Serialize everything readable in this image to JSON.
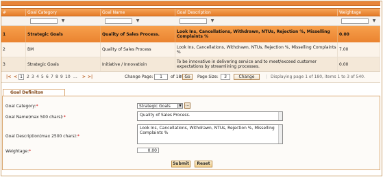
{
  "grid": {
    "columns": [
      "#",
      "Goal Category",
      "Goal Name",
      "Goal Description",
      "Weightage"
    ],
    "filter_icon": "filter-icon",
    "rows": [
      {
        "num": "1",
        "category": "Strategic Goals",
        "name": "Quality of Sales Process.",
        "description": "Look Ins, Cancellations, Withdrawn, NTUs, Rejection %, Misselling Complaints %",
        "weightage": "0.00"
      },
      {
        "num": "2",
        "category": "BM",
        "name": "Quality of Sales Process",
        "description": "Look Ins, Cancellations, Withdrawn, NTUs, Rejection %, Misselling Complaints %",
        "weightage": "7.00"
      },
      {
        "num": "3",
        "category": "Strategic Goals",
        "name": "Initiative / Innovatioin",
        "description": "To be innovative in delivering service and to meet/exceed customer expectations by streamlining processes.",
        "weightage": "0.00"
      }
    ]
  },
  "pager": {
    "first": "|<",
    "prev": "<",
    "current": "1",
    "pages": [
      "2",
      "3",
      "4",
      "5",
      "6",
      "7",
      "8",
      "9",
      "10"
    ],
    "ellipsis": "...",
    "next": ">",
    "last": ">|",
    "change_page_label": "Change Page:",
    "change_page_value": "1",
    "of_label": "of 180",
    "go_label": "Go",
    "page_size_label": "Page Size:",
    "page_size_value": "3",
    "change_label": "Change",
    "status": "Displaying page 1 of 180, items 1 to 3 of 540."
  },
  "form": {
    "tab_label": "Goal Definiton",
    "category_label": "Goal Category:",
    "category_value": "Strategic Goals",
    "lookup_label": "...",
    "name_label": "Goal Name(max 500 chars):",
    "name_value": "Quality of Sales Process.",
    "description_label": "Goal Description(max 2500 chars):",
    "description_value": "Look Ins, Cancellations, Withdrawn, NTUs, Rejection %, Misselling Complaints %",
    "weightage_label": "Weightage:",
    "weightage_value": "0.00",
    "required_mark": "*",
    "submit_label": "Submit",
    "reset_label": "Reset"
  },
  "colors": {
    "header": "#e47c28",
    "selected_row": "#ea8330",
    "accent_border": "#d9a66f"
  }
}
